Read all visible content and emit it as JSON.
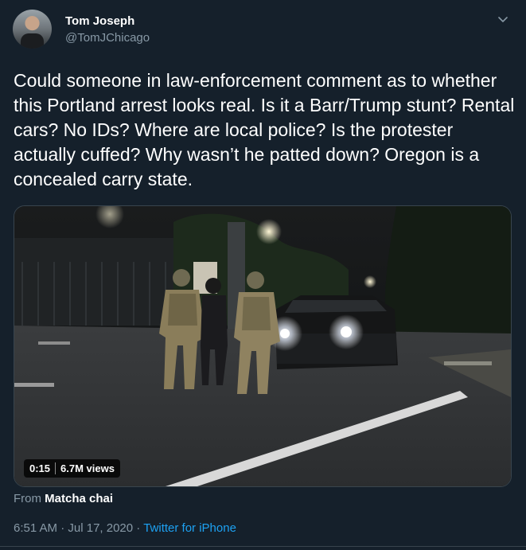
{
  "author": {
    "name": "Tom Joseph",
    "handle": "@TomJChicago"
  },
  "icons": {
    "more": "chevron-down-icon",
    "avatar": "profile-photo"
  },
  "tweet": {
    "text": "Could someone in law-enforcement comment as to whether this Portland arrest looks real. Is it a Barr/Trump stunt? Rental cars? No IDs? Where are local police? Is the protester actually cuffed? Why wasn’t he patted down? Oregon is a concealed carry state."
  },
  "video": {
    "duration": "0:15",
    "views": "6.7M views"
  },
  "attribution": {
    "prefix": "From",
    "source_account": "Matcha chai"
  },
  "meta": {
    "time": "6:51 AM",
    "separator_1": "·",
    "date": "Jul 17, 2020",
    "separator_2": "·",
    "client": "Twitter for iPhone"
  },
  "colors": {
    "background": "#15202b",
    "secondary_text": "#8899a6",
    "link": "#1da1f2"
  }
}
